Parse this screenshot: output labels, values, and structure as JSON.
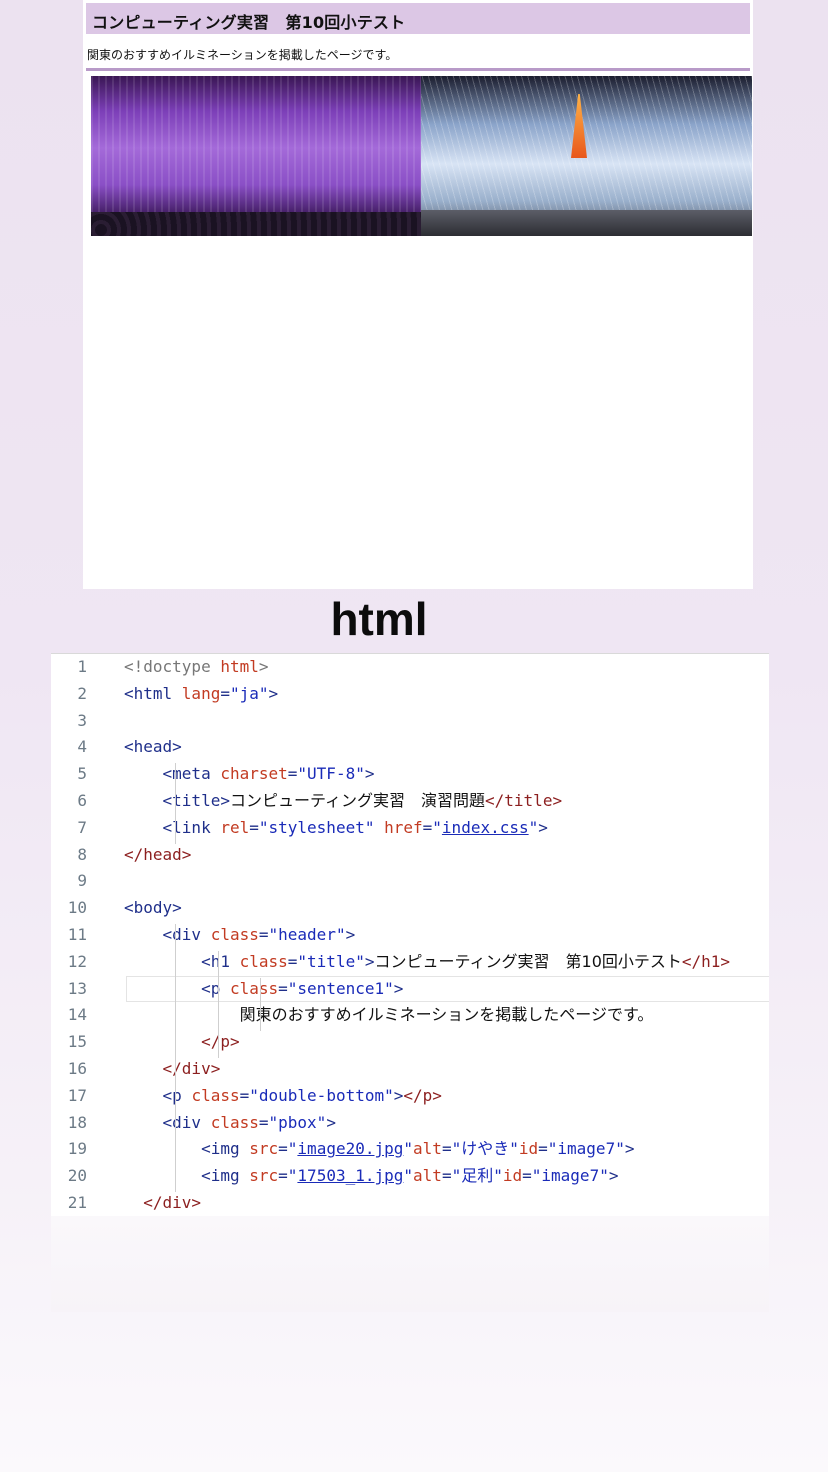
{
  "preview": {
    "title": "コンピューティング実習　第10回小テスト",
    "sentence": "関東のおすすめイルミネーションを掲載したページです。",
    "images": [
      {
        "alt": "けやき",
        "subject": "wisteria illumination photo"
      },
      {
        "alt": "足利",
        "subject": "keyaki tree illumination with tower photo"
      }
    ]
  },
  "section_heading": "html",
  "code_lines": [
    {
      "n": "1",
      "indent": "",
      "parts": [
        [
          "g",
          "<!doctype "
        ],
        [
          "a",
          "html"
        ],
        [
          "g",
          ">"
        ]
      ]
    },
    {
      "n": "2",
      "indent": "",
      "parts": [
        [
          "t",
          "<html "
        ],
        [
          "a",
          "lang"
        ],
        [
          "t",
          "="
        ],
        [
          "s",
          "\"ja\""
        ],
        [
          "t",
          ">"
        ]
      ]
    },
    {
      "n": "3",
      "indent": "",
      "parts": []
    },
    {
      "n": "4",
      "indent": "",
      "parts": [
        [
          "t",
          "<head>"
        ]
      ]
    },
    {
      "n": "5",
      "indent": "    ",
      "parts": [
        [
          "t",
          "<meta "
        ],
        [
          "a",
          "charset"
        ],
        [
          "t",
          "="
        ],
        [
          "s",
          "\"UTF-8\""
        ],
        [
          "t",
          ">"
        ]
      ]
    },
    {
      "n": "6",
      "indent": "    ",
      "parts": [
        [
          "t",
          "<title>"
        ],
        [
          "x",
          "コンピューティング実習　演習問題"
        ],
        [
          "bt",
          "</title>"
        ]
      ]
    },
    {
      "n": "7",
      "indent": "    ",
      "parts": [
        [
          "t",
          "<link "
        ],
        [
          "a",
          "rel"
        ],
        [
          "t",
          "="
        ],
        [
          "s",
          "\"stylesheet\" "
        ],
        [
          "a",
          "href"
        ],
        [
          "t",
          "="
        ],
        [
          "s",
          "\""
        ],
        [
          "u",
          "index.css"
        ],
        [
          "s",
          "\""
        ],
        [
          "t",
          ">"
        ]
      ]
    },
    {
      "n": "8",
      "indent": "",
      "parts": [
        [
          "bt",
          "</head>"
        ]
      ]
    },
    {
      "n": "9",
      "indent": "",
      "parts": []
    },
    {
      "n": "10",
      "indent": "",
      "parts": [
        [
          "t",
          "<body>"
        ]
      ]
    },
    {
      "n": "11",
      "indent": "    ",
      "parts": [
        [
          "t",
          "<div "
        ],
        [
          "a",
          "class"
        ],
        [
          "t",
          "="
        ],
        [
          "s",
          "\"header\""
        ],
        [
          "t",
          ">"
        ]
      ]
    },
    {
      "n": "12",
      "indent": "        ",
      "parts": [
        [
          "t",
          "<h1 "
        ],
        [
          "a",
          "class"
        ],
        [
          "t",
          "="
        ],
        [
          "s",
          "\"title\""
        ],
        [
          "t",
          ">"
        ],
        [
          "x",
          "コンピューティング実習　第10回小テスト"
        ],
        [
          "bt",
          "</h1>"
        ]
      ]
    },
    {
      "n": "13",
      "indent": "        ",
      "parts": [
        [
          "t",
          "<p "
        ],
        [
          "a",
          "class"
        ],
        [
          "t",
          "="
        ],
        [
          "s",
          "\"sentence1\""
        ],
        [
          "t",
          ">"
        ]
      ]
    },
    {
      "n": "14",
      "indent": "            ",
      "parts": [
        [
          "x",
          "関東のおすすめイルミネーションを掲載したページです。"
        ]
      ]
    },
    {
      "n": "15",
      "indent": "        ",
      "parts": [
        [
          "bt",
          "</p>"
        ]
      ]
    },
    {
      "n": "16",
      "indent": "    ",
      "parts": [
        [
          "bt",
          "</div>"
        ]
      ]
    },
    {
      "n": "17",
      "indent": "    ",
      "parts": [
        [
          "t",
          "<p "
        ],
        [
          "a",
          "class"
        ],
        [
          "t",
          "="
        ],
        [
          "s",
          "\"double-bottom\""
        ],
        [
          "t",
          ">"
        ],
        [
          "bt",
          "</p>"
        ]
      ]
    },
    {
      "n": "18",
      "indent": "    ",
      "parts": [
        [
          "t",
          "<div "
        ],
        [
          "a",
          "class"
        ],
        [
          "t",
          "="
        ],
        [
          "s",
          "\"pbox\""
        ],
        [
          "t",
          ">"
        ]
      ]
    },
    {
      "n": "19",
      "indent": "        ",
      "parts": [
        [
          "t",
          "<img "
        ],
        [
          "a",
          "src"
        ],
        [
          "t",
          "="
        ],
        [
          "s",
          "\""
        ],
        [
          "u",
          "image20.jpg"
        ],
        [
          "s",
          "\""
        ],
        [
          "a",
          "alt"
        ],
        [
          "t",
          "="
        ],
        [
          "s",
          "\"けやき\""
        ],
        [
          "a",
          "id"
        ],
        [
          "t",
          "="
        ],
        [
          "s",
          "\"image7\""
        ],
        [
          "t",
          ">"
        ]
      ]
    },
    {
      "n": "20",
      "indent": "        ",
      "parts": [
        [
          "t",
          "<img "
        ],
        [
          "a",
          "src"
        ],
        [
          "t",
          "="
        ],
        [
          "s",
          "\""
        ],
        [
          "u",
          "17503_1.jpg"
        ],
        [
          "s",
          "\""
        ],
        [
          "a",
          "alt"
        ],
        [
          "t",
          "="
        ],
        [
          "s",
          "\"足利\""
        ],
        [
          "a",
          "id"
        ],
        [
          "t",
          "="
        ],
        [
          "s",
          "\"image7\""
        ],
        [
          "t",
          ">"
        ]
      ]
    },
    {
      "n": "21",
      "indent": "  ",
      "parts": [
        [
          "bt",
          "</div>"
        ]
      ]
    }
  ],
  "active_line": "13",
  "colors": {
    "header_band": "#dcc7e5",
    "rule": "#b89ac8",
    "tag": "#1f2f8a",
    "attribute": "#c23b22",
    "string": "#1a2bb8"
  }
}
